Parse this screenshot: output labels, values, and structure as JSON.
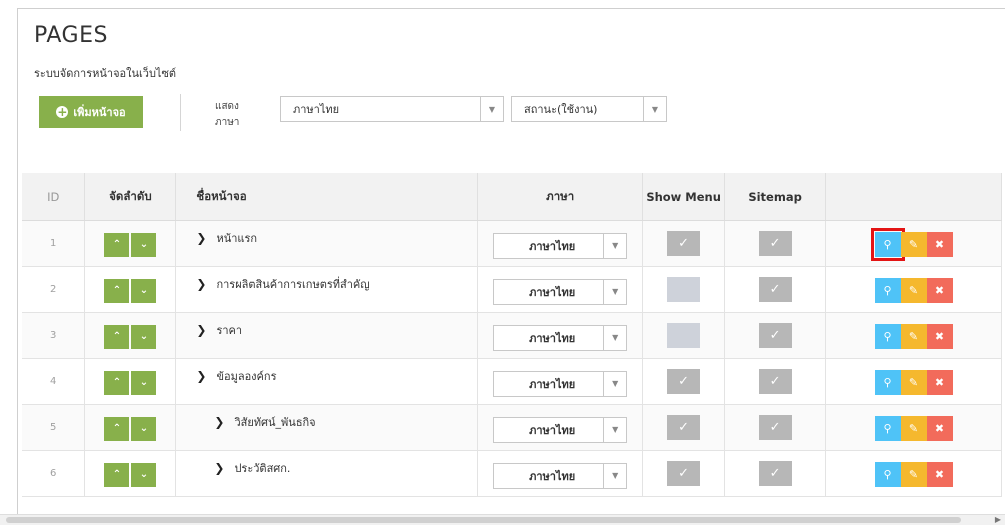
{
  "header": {
    "title": "PAGES",
    "subtitle": "ระบบจัดการหน้าจอในเว็บไซต์"
  },
  "toolbar": {
    "add_label": "เพิ่มหน้าจอ",
    "lang_label": "แสดงภาษา",
    "lang_value": "ภาษาไทย",
    "status_value": "สถานะ(ใช้งาน)"
  },
  "table": {
    "columns": {
      "id": "ID",
      "order": "จัดลำดับ",
      "name": "ชื่อหน้าจอ",
      "language": "ภาษา",
      "show_menu": "Show Menu",
      "sitemap": "Sitemap"
    },
    "rows": [
      {
        "id": "1",
        "name": "หน้าแรก",
        "language": "ภาษาไทย",
        "show_menu": true,
        "sitemap": true
      },
      {
        "id": "2",
        "name": "การผลิตสินค้าการเกษตรที่สำคัญ",
        "language": "ภาษาไทย",
        "show_menu": false,
        "sitemap": true
      },
      {
        "id": "3",
        "name": "ราคา",
        "language": "ภาษาไทย",
        "show_menu": false,
        "sitemap": true
      },
      {
        "id": "4",
        "name": "ข้อมูลองค์กร",
        "language": "ภาษาไทย",
        "show_menu": true,
        "sitemap": true
      },
      {
        "id": "5",
        "name": "วิสัยทัศน์_พันธกิจ",
        "language": "ภาษาไทย",
        "show_menu": true,
        "sitemap": true
      },
      {
        "id": "6",
        "name": "ประวัติสศก.",
        "language": "ภาษาไทย",
        "show_menu": true,
        "sitemap": true
      }
    ]
  },
  "colors": {
    "green": "#88b04b",
    "view": "#4fc3f7",
    "edit": "#f5b82e",
    "delete": "#f26b5b",
    "highlight": "#e31414"
  },
  "icons": {
    "up": "chevron-up-icon",
    "down": "chevron-down-icon",
    "expand": "chevron-right-icon",
    "check": "check-icon",
    "view": "search-icon",
    "edit": "edit-icon",
    "delete": "close-icon"
  }
}
